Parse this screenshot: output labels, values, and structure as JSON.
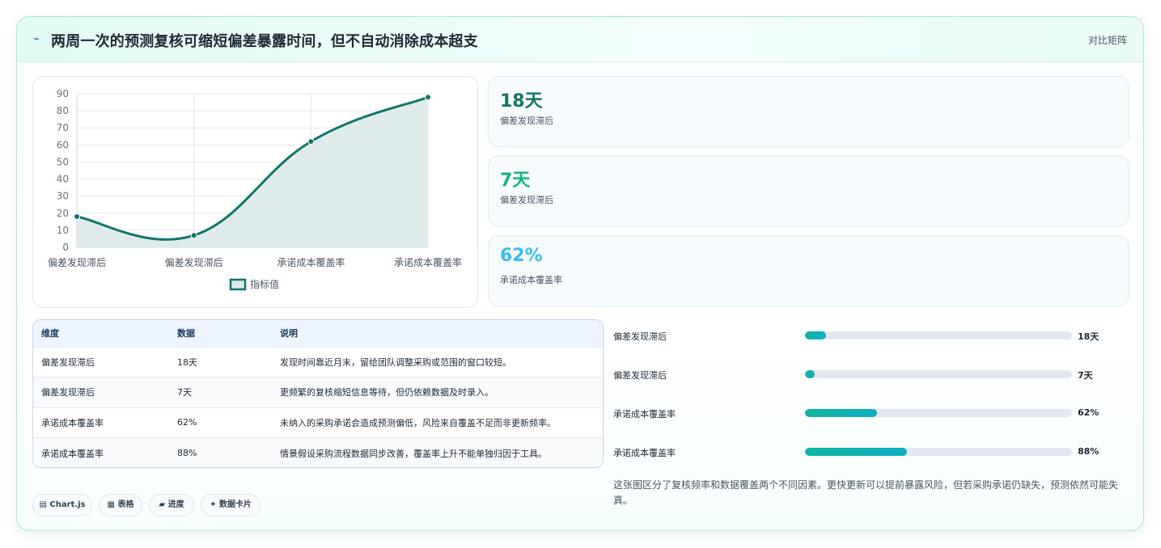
{
  "header": {
    "icon": "⌁",
    "title": "两周一次的预测复核可缩短偏差暴露时间，但不自动消除成本超支",
    "link_label": "对比矩阵"
  },
  "chart_data": {
    "type": "line",
    "categories": [
      "偏差发现滞后",
      "偏差发现滞后",
      "承诺成本覆盖率",
      "承诺成本覆盖率"
    ],
    "series": [
      {
        "name": "指标值",
        "values": [
          18,
          7,
          62,
          88
        ]
      }
    ],
    "ylim": [
      0,
      90
    ],
    "yticks": [
      0,
      10,
      20,
      30,
      40,
      50,
      60,
      70,
      80,
      90
    ],
    "grid": true,
    "fill": true,
    "legend_position": "bottom",
    "colors": {
      "line": "#13756b",
      "fill": "#dbe9e8"
    }
  },
  "stats": [
    {
      "value": "18天",
      "label": "偏差发现滞后",
      "color": "#13756b"
    },
    {
      "value": "7天",
      "label": "偏差发现滞后",
      "color": "#10b981"
    },
    {
      "value": "62%",
      "label": "承诺成本覆盖率",
      "color": "#38bdf8"
    }
  ],
  "table": {
    "headers": [
      "维度",
      "数据",
      "说明"
    ],
    "rows": [
      [
        "偏差发现滞后",
        "18天",
        "发现时间靠近月末，留给团队调整采购或范围的窗口较短。"
      ],
      [
        "偏差发现滞后",
        "7天",
        "更频繁的复核缩短信息等待，但仍依赖数据及时录入。"
      ],
      [
        "承诺成本覆盖率",
        "62%",
        "未纳入的采购承诺会造成预测偏低，风险来自覆盖不足而非更新频率。"
      ],
      [
        "承诺成本覆盖率",
        "88%",
        "情景假设采购流程数据同步改善，覆盖率上升不能单独归因于工具。"
      ]
    ]
  },
  "progress": [
    {
      "label": "偏差发现滞后",
      "value": "18天",
      "fraction": 0.078
    },
    {
      "label": "偏差发现滞后",
      "value": "7天",
      "fraction": 0.035
    },
    {
      "label": "承诺成本覆盖率",
      "value": "62%",
      "fraction": 0.27
    },
    {
      "label": "承诺成本覆盖率",
      "value": "88%",
      "fraction": 0.383
    }
  ],
  "note": "这张图区分了复核频率和数据覆盖两个不同因素。更快更新可以提前暴露风险，但若采购承诺仍缺失，预测依然可能失真。",
  "chips": [
    {
      "icon": "▤",
      "label": "Chart.js"
    },
    {
      "icon": "▦",
      "label": "表格"
    },
    {
      "icon": "▰",
      "label": "进度"
    },
    {
      "icon": "✦",
      "label": "数据卡片"
    }
  ]
}
